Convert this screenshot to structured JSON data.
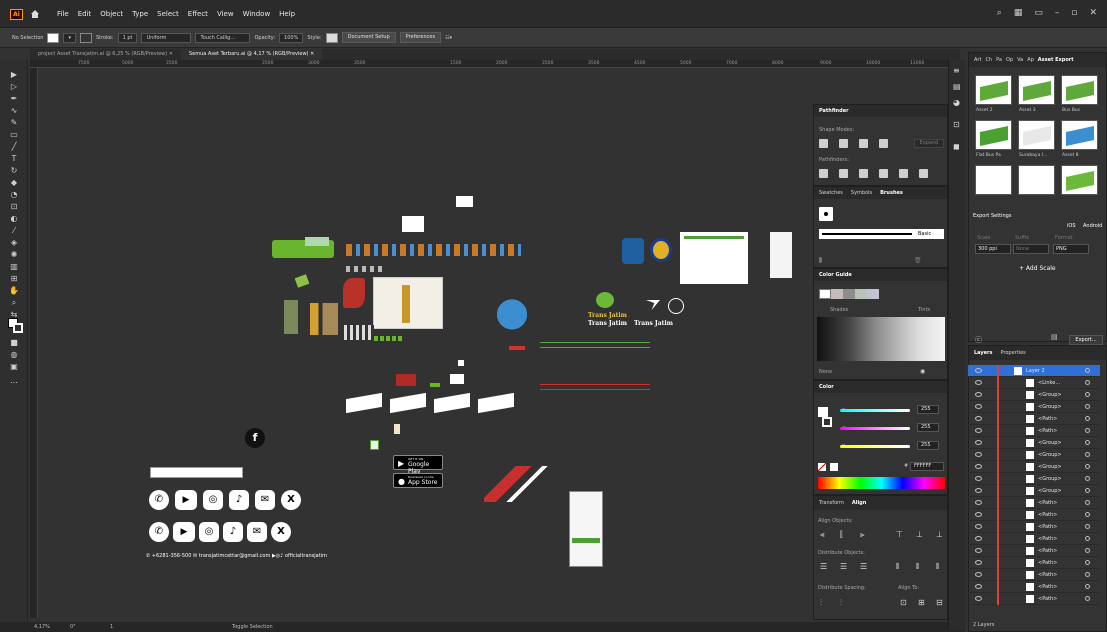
{
  "app": {
    "logo": "Ai",
    "menu": [
      "File",
      "Edit",
      "Object",
      "Type",
      "Select",
      "Effect",
      "View",
      "Window",
      "Help"
    ]
  },
  "control": {
    "selection": "No Selection",
    "stroke_label": "Stroke:",
    "stroke_val": "1 pt",
    "uniform": "Uniform",
    "brush": "Touch Callig...",
    "opacity_label": "Opacity:",
    "opacity_val": "100%",
    "style_label": "Style:",
    "doc_setup": "Document Setup",
    "preferences": "Preferences"
  },
  "tabs": [
    "project Asset Transjatim.ai @ 6,25 % (RGB/Preview)",
    "Semua Aset Terbaru.ai @ 4,17 % (RGB/Preview)"
  ],
  "ruler": [
    "7500",
    "5000",
    "2500",
    "1000",
    "2000",
    "2500",
    "3000",
    "3500",
    "1000",
    "1500",
    "2000",
    "2500",
    "3000",
    "3500",
    "4000",
    "4500",
    "5000",
    "5500",
    "7000",
    "7500",
    "8000",
    "8500",
    "9000",
    "9500",
    "10000",
    "10500",
    "11000"
  ],
  "status": {
    "zoom": "4,17%",
    "angle": "0°",
    "page": "1",
    "mode": "Toggle Selection"
  },
  "pathfinder": {
    "title": "Pathfinder",
    "shape_modes": "Shape Modes:",
    "expand": "Expand",
    "pathfinders": "Pathfinders:"
  },
  "brushes": {
    "tabs": [
      "Swatches",
      "Symbols",
      "Brushes"
    ],
    "basic": "Basic"
  },
  "color_guide": {
    "title": "Color Guide",
    "shades": "Shades",
    "tints": "Tints",
    "none": "None"
  },
  "color": {
    "title": "Color",
    "r": "255",
    "g": "255",
    "b": "255",
    "hex": "FFFFFF"
  },
  "align": {
    "tabs": [
      "Transform",
      "Align"
    ],
    "align_objects": "Align Objects:",
    "distribute_objects": "Distribute Objects:",
    "distribute_spacing": "Distribute Spacing:",
    "align_to": "Align To:"
  },
  "asset_export": {
    "tabs": [
      "Art",
      "Ch",
      "Pa",
      "Op",
      "Va",
      "Ap",
      "Asset Export"
    ],
    "assets": [
      {
        "name": "Asset 2",
        "color": "#5fa83a"
      },
      {
        "name": "Asset 3",
        "color": "#5fa83a"
      },
      {
        "name": "Bus Bus",
        "color": "#5fa83a"
      },
      {
        "name": "Flat Bus Pa",
        "color": "#4aa030"
      },
      {
        "name": "Surabaya I...",
        "color": "#e8e8e8"
      },
      {
        "name": "Asset 8",
        "color": "#3b8fd0"
      },
      {
        "name": "",
        "color": "#ffffff"
      },
      {
        "name": "",
        "color": "#ffffff"
      },
      {
        "name": "",
        "color": "#6cb83a"
      }
    ],
    "export_settings": "Export Settings",
    "ios": "iOS",
    "android": "Android",
    "scale_label": "Scale",
    "suffix_label": "Suffix",
    "format_label": "Format",
    "scale": "300 ppi",
    "suffix": "None",
    "format": "PNG",
    "add_scale": "+ Add Scale",
    "export_btn": "Export..."
  },
  "layers": {
    "tabs": [
      "Layers",
      "Properties"
    ],
    "count": "2 Layers",
    "rows": [
      "Layer 2",
      "<Linke...",
      "<Group>",
      "<Group>",
      "<Path>",
      "<Path>",
      "<Group>",
      "<Group>",
      "<Group>",
      "<Group>",
      "<Group>",
      "<Path>",
      "<Path>",
      "<Path>",
      "<Path>",
      "<Path>",
      "<Path>",
      "<Path>",
      "<Path>",
      "<Path>"
    ]
  },
  "canvas_text": {
    "trans1": "Trans Jatim",
    "trans2": "Trans Jatim",
    "trans3": "Trans Jatim",
    "google": "Google Play",
    "apple": "App Store",
    "get_it": "GET IT ON",
    "download": "Download on the",
    "contact": "+6281-356-500",
    "email": "transjatimcettar@gmail.com",
    "handle": "officialtransjatim"
  }
}
